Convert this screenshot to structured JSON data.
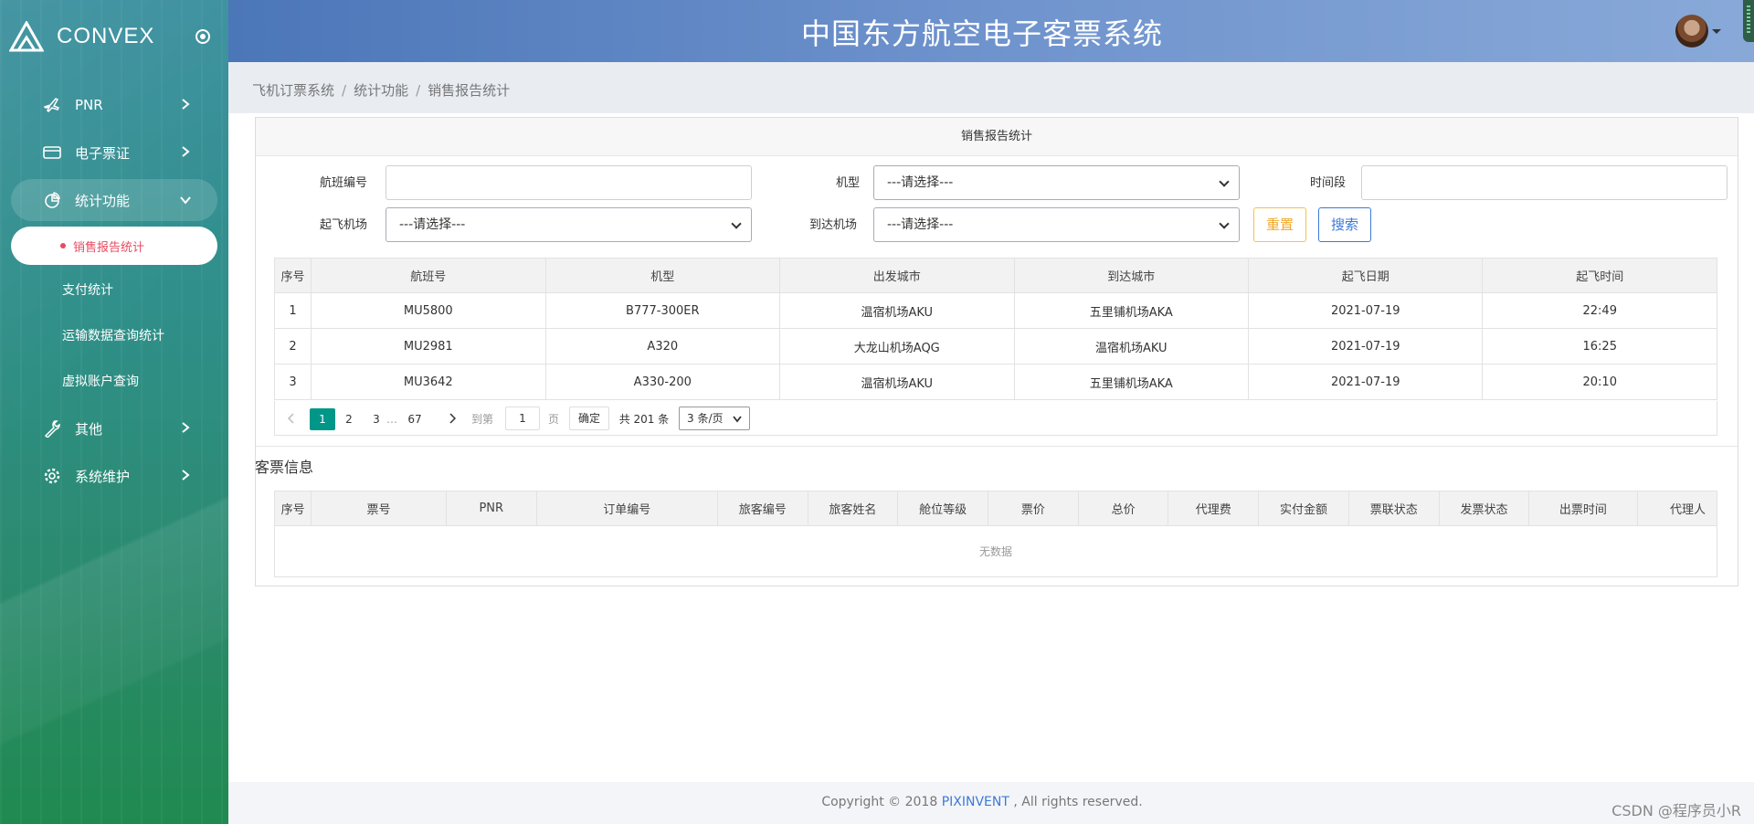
{
  "sidebar": {
    "brand": "CONVEX",
    "items": [
      {
        "label": "PNR"
      },
      {
        "label": "电子票证"
      },
      {
        "label": "统计功能"
      },
      {
        "label": "其他"
      },
      {
        "label": "系统维护"
      }
    ],
    "stats_submenu": {
      "active": "销售报告统计",
      "items": [
        "支付统计",
        "运输数据查询统计",
        "虚拟账户查询"
      ]
    }
  },
  "header": {
    "title": "中国东方航空电子客票系统"
  },
  "breadcrumb": [
    "飞机订票系统",
    "统计功能",
    "销售报告统计"
  ],
  "panel": {
    "title": "销售报告统计",
    "filters": {
      "flight_no_label": "航班编号",
      "aircraft_label": "机型",
      "aircraft_value": "---请选择---",
      "period_label": "时间段",
      "departure_label": "起飞机场",
      "departure_value": "---请选择---",
      "arrival_label": "到达机场",
      "arrival_value": "---请选择---",
      "reset": "重置",
      "search": "搜索"
    },
    "flights_table": {
      "headers": [
        "序号",
        "航班号",
        "机型",
        "出发城市",
        "到达城市",
        "起飞日期",
        "起飞时间"
      ],
      "rows": [
        [
          "1",
          "MU5800",
          "B777-300ER",
          "温宿机场AKU",
          "五里铺机场AKA",
          "2021-07-19",
          "22:49"
        ],
        [
          "2",
          "MU2981",
          "A320",
          "大龙山机场AQG",
          "温宿机场AKU",
          "2021-07-19",
          "16:25"
        ],
        [
          "3",
          "MU3642",
          "A330-200",
          "温宿机场AKU",
          "五里铺机场AKA",
          "2021-07-19",
          "20:10"
        ]
      ]
    },
    "pager": {
      "pages": [
        "1",
        "2",
        "3",
        "…",
        "67"
      ],
      "goto_label": "到第",
      "goto_value": "1",
      "page_unit": "页",
      "confirm": "确定",
      "total": "共 201 条",
      "per_page": "3 条/页"
    },
    "tickets": {
      "title": "客票信息",
      "headers": [
        "序号",
        "票号",
        "PNR",
        "订单编号",
        "旅客编号",
        "旅客姓名",
        "舱位等级",
        "票价",
        "总价",
        "代理费",
        "实付金额",
        "票联状态",
        "发票状态",
        "出票时间",
        "代理人"
      ],
      "empty": "无数据"
    }
  },
  "footer": {
    "prefix": "Copyright © 2018 ",
    "brand": "PIXINVENT",
    "suffix": " , All rights reserved."
  },
  "watermark": "CSDN @程序员小R",
  "colors": {
    "accent": "#009688",
    "active_text": "#e84a5f",
    "reset": "#f0a82c",
    "search": "#3b7ad8"
  }
}
